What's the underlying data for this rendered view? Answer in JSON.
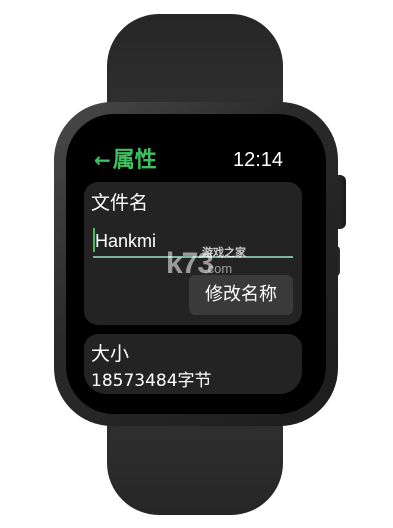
{
  "header": {
    "back_arrow": "←",
    "title": "属性",
    "time": "12:14"
  },
  "filename_card": {
    "label": "文件名",
    "input_value": "Hankmi",
    "rename_button": "修改名称"
  },
  "size_card": {
    "label": "大小",
    "value": "18573484字节"
  },
  "watermark": {
    "logo": "k73",
    "tagline": "游戏之家",
    "domain": ".com"
  },
  "colors": {
    "accent": "#3fc060",
    "screen": "#000000",
    "card": "#232323",
    "button": "#3a3a3a"
  }
}
